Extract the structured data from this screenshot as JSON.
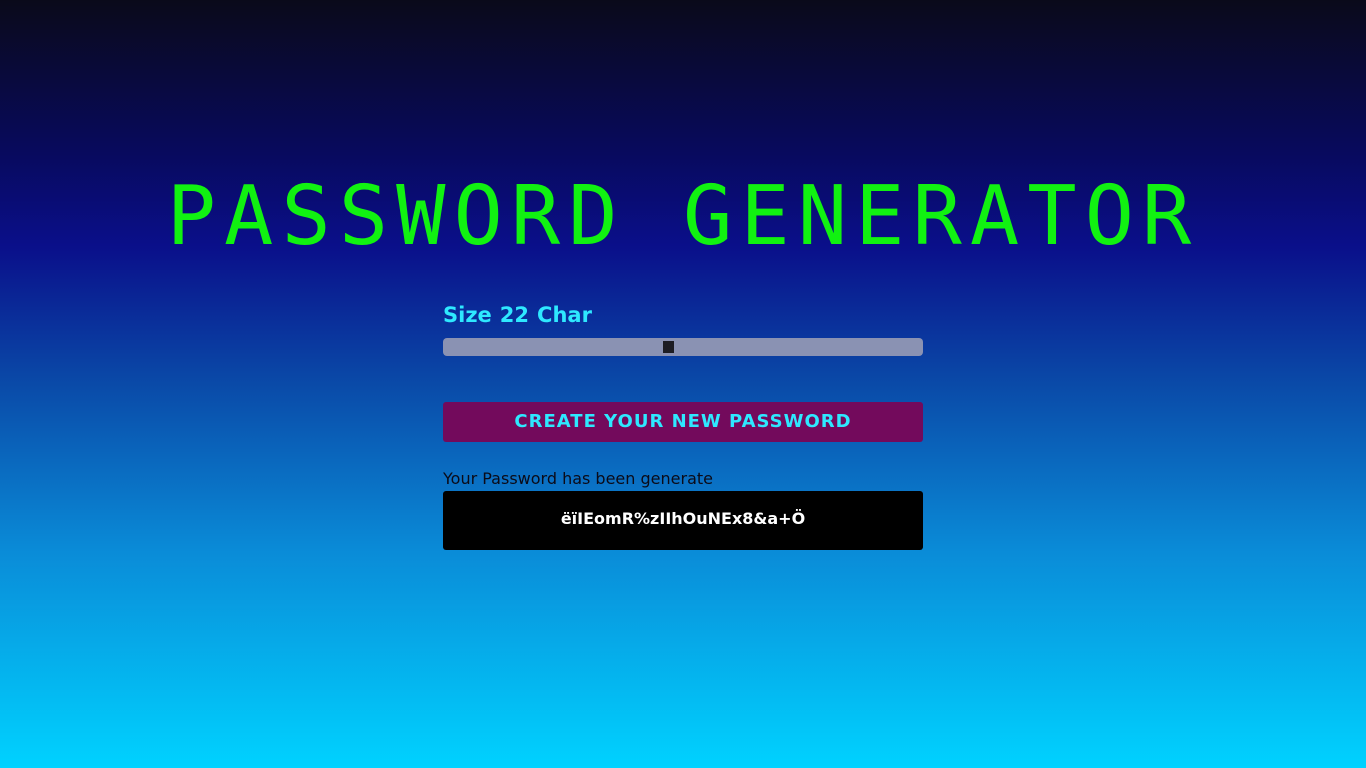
{
  "header": {
    "title": "PASSWORD GENERATOR"
  },
  "size_control": {
    "prefix": "Size",
    "value": "22",
    "suffix": "Char",
    "slider_fraction": 0.47
  },
  "create_button": {
    "label": "CREATE YOUR NEW PASSWORD"
  },
  "result": {
    "label": "Your Password has been generate",
    "password": "ëïIEomR%zIIhOuNEx8&a+Ö"
  },
  "colors": {
    "title": "#11f211",
    "accent": "#2ee8ff",
    "button_bg": "#730a5c",
    "result_bg": "#000000"
  }
}
